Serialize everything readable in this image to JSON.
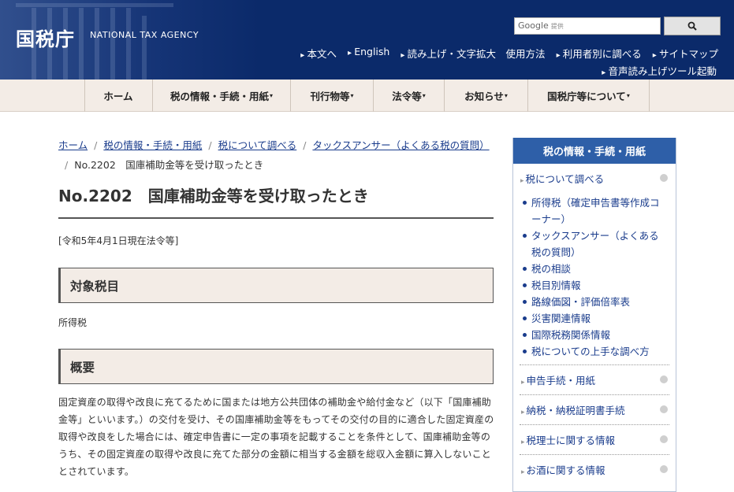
{
  "header": {
    "logo": "国税庁",
    "logo_sub": "NATIONAL TAX AGENCY",
    "search_placeholder": "Google",
    "search_provider": "提供",
    "util_links": [
      "本文へ",
      "English",
      "読み上げ・文字拡大　使用方法",
      "利用者別に調べる",
      "サイトマップ"
    ],
    "util_link2": "音声読み上げツール起動"
  },
  "gnav": [
    {
      "label": "ホーム",
      "caret": ""
    },
    {
      "label": "税の情報・手続・用紙",
      "caret": "▾"
    },
    {
      "label": "刊行物等",
      "caret": "▾"
    },
    {
      "label": "法令等",
      "caret": "▾"
    },
    {
      "label": "お知らせ",
      "caret": "▾"
    },
    {
      "label": "国税庁等について",
      "caret": "▾"
    }
  ],
  "breadcrumb": [
    "ホーム",
    "税の情報・手続・用紙",
    "税について調べる",
    "タックスアンサー（よくある税の質問）",
    "No.2202　国庫補助金等を受け取ったとき"
  ],
  "main": {
    "title": "No.2202　国庫補助金等を受け取ったとき",
    "as_of": "[令和5年4月1日現在法令等]",
    "sec1_heading": "対象税目",
    "sec1_body": "所得税",
    "sec2_heading": "概要",
    "sec2_body": "固定資産の取得や改良に充てるために国または地方公共団体の補助金や給付金など（以下「国庫補助金等」といいます。）の交付を受け、その国庫補助金等をもってその交付の目的に適合した固定資産の取得や改良をした場合には、確定申告書に一定の事項を記載することを条件として、国庫補助金等のうち、その固定資産の取得や改良に充てた部分の金額に相当する金額を総収入金額に算入しないこととされています。"
  },
  "side": {
    "heading": "税の情報・手続・用紙",
    "cat1": "税について調べる",
    "items": [
      "所得税（確定申告書等作成コーナー）",
      "タックスアンサー（よくある税の質問）",
      "税の相談",
      "税目別情報",
      "路線価図・評価倍率表",
      "災害関連情報",
      "国際税務関係情報",
      "税についての上手な調べ方"
    ],
    "cats": [
      "申告手続・用紙",
      "納税・納税証明書手続",
      "税理士に関する情報",
      "お酒に関する情報"
    ]
  }
}
